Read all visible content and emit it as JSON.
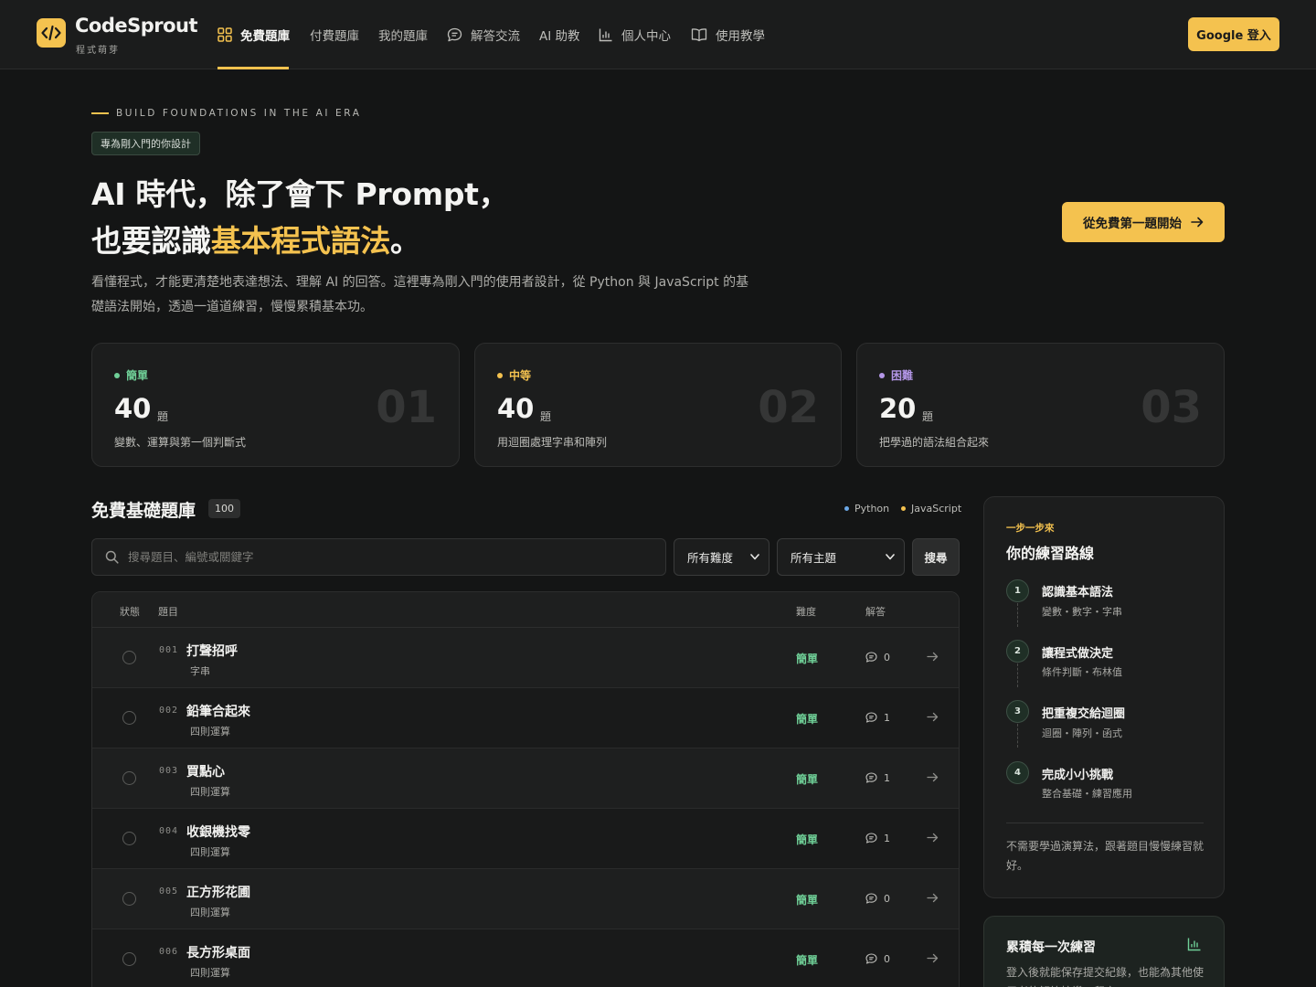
{
  "brand": {
    "name": "CodeSprout",
    "subtitle": "程式萌芽"
  },
  "nav": {
    "items": [
      {
        "label": "免費題庫",
        "icon": "grid-icon",
        "active": true
      },
      {
        "label": "付費題庫"
      },
      {
        "label": "我的題庫"
      },
      {
        "label": "解答交流",
        "icon": "chat-icon"
      },
      {
        "label": "AI 助教"
      },
      {
        "label": "個人中心",
        "icon": "chart-icon"
      },
      {
        "label": "使用教學",
        "icon": "book-icon"
      }
    ],
    "login_label": "Google 登入"
  },
  "hero": {
    "eyebrow": "BUILD FOUNDATIONS IN THE AI ERA",
    "tag": "專為剛入門的你設計",
    "line1": "AI 時代，除了會下 Prompt，",
    "line2_prefix": "也要認識",
    "line2_highlight": "基本程式語法",
    "line2_suffix": "。",
    "description": "看懂程式，才能更清楚地表達想法、理解 AI 的回答。這裡專為剛入門的使用者設計，從 Python 與 JavaScript 的基礎語法開始，透過一道道練習，慢慢累積基本功。",
    "cta_label": "從免費第一題開始"
  },
  "levels": [
    {
      "label": "簡單",
      "count": "40",
      "unit": "題",
      "desc": "變數、運算與第一個判斷式",
      "index": "01",
      "color": "#6fcf97"
    },
    {
      "label": "中等",
      "count": "40",
      "unit": "題",
      "desc": "用迴圈處理字串和陣列",
      "index": "02",
      "color": "#f4c24f"
    },
    {
      "label": "困難",
      "count": "20",
      "unit": "題",
      "desc": "把學過的語法組合起來",
      "index": "03",
      "color": "#b497e8"
    }
  ],
  "list": {
    "title": "免費基礎題庫",
    "count": "100",
    "legend": [
      {
        "label": "Python",
        "color": "#6ba8e6"
      },
      {
        "label": "JavaScript",
        "color": "#f4c24f"
      }
    ],
    "search_placeholder": "搜尋題目、編號或關鍵字",
    "difficulty_select": "所有難度",
    "topic_select": "所有主題",
    "search_button": "搜尋",
    "columns": {
      "status": "狀態",
      "title": "題目",
      "difficulty": "難度",
      "answers": "解答"
    },
    "rows": [
      {
        "num": "001",
        "title": "打聲招呼",
        "topic": "字串",
        "difficulty": "簡單",
        "answers": "0"
      },
      {
        "num": "002",
        "title": "鉛筆合起來",
        "topic": "四則運算",
        "difficulty": "簡單",
        "answers": "1"
      },
      {
        "num": "003",
        "title": "買點心",
        "topic": "四則運算",
        "difficulty": "簡單",
        "answers": "1"
      },
      {
        "num": "004",
        "title": "收銀機找零",
        "topic": "四則運算",
        "difficulty": "簡單",
        "answers": "1"
      },
      {
        "num": "005",
        "title": "正方形花圃",
        "topic": "四則運算",
        "difficulty": "簡單",
        "answers": "0"
      },
      {
        "num": "006",
        "title": "長方形桌面",
        "topic": "四則運算",
        "difficulty": "簡單",
        "answers": "0"
      }
    ]
  },
  "path": {
    "eyebrow": "一步一步來",
    "title": "你的練習路線",
    "steps": [
      {
        "n": "1",
        "title": "認識基本語法",
        "sub": "變數・數字・字串"
      },
      {
        "n": "2",
        "title": "讓程式做決定",
        "sub": "條件判斷・布林值"
      },
      {
        "n": "3",
        "title": "把重複交給迴圈",
        "sub": "迴圈・陣列・函式"
      },
      {
        "n": "4",
        "title": "完成小小挑戰",
        "sub": "整合基礎・練習應用"
      }
    ],
    "note": "不需要學過演算法，跟著題目慢慢練習就好。"
  },
  "accumulate": {
    "title": "累積每一次練習",
    "desc": "登入後就能保存提交紀錄，也能為其他使用者的解答按讚、留言。"
  }
}
